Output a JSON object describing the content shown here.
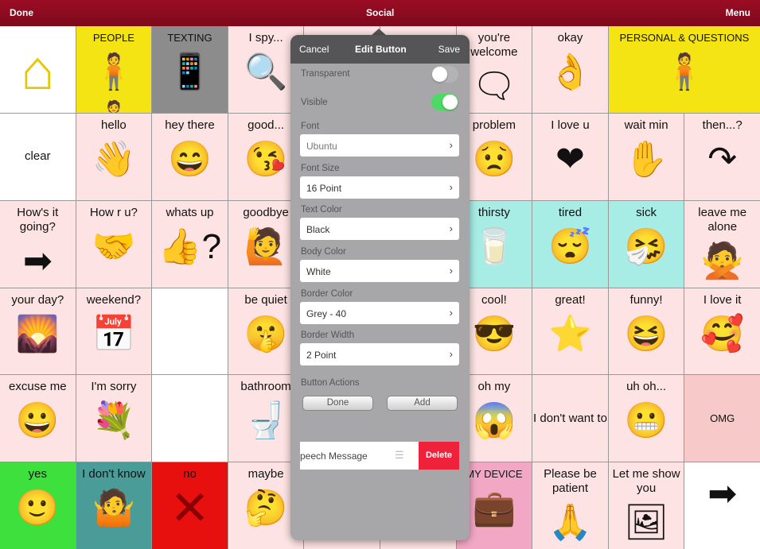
{
  "topbar": {
    "left": "Done",
    "title": "Social",
    "right": "Menu"
  },
  "cells": [
    {
      "label": "",
      "icon": "house-icon",
      "glyph": "⌂",
      "bg": "#ffffff"
    },
    {
      "label": "PEOPLE",
      "icon": "people-icon",
      "glyph": "🧍🧍🧍",
      "bg": "#f5e414"
    },
    {
      "label": "TEXTING",
      "icon": "phone-texting-icon",
      "glyph": "📱",
      "bg": "#8c8c8c"
    },
    {
      "label": "I spy...",
      "icon": "magnifier-icon",
      "glyph": "🔍",
      "bg": "#fde3e3"
    },
    {
      "label": "",
      "icon": "",
      "glyph": "",
      "bg": "#fde3e3"
    },
    {
      "label": "",
      "icon": "",
      "glyph": "",
      "bg": "#fde3e3"
    },
    {
      "label": "you're welcome",
      "icon": "people-talking-icon",
      "glyph": "🗨",
      "bg": "#fde3e3"
    },
    {
      "label": "okay",
      "icon": "ok-hand-icon",
      "glyph": "👌",
      "bg": "#fde3e3"
    },
    {
      "label": "PERSONAL & QUESTIONS",
      "icon": "person-icon",
      "glyph": "🧍",
      "bg": "#f5e414",
      "span": 2
    },
    {
      "label": "clear",
      "icon": "",
      "glyph": "",
      "bg": "#ffffff",
      "mid": true
    },
    {
      "label": "hello",
      "icon": "waving-icon",
      "glyph": "👋",
      "bg": "#fde3e3"
    },
    {
      "label": "hey there",
      "icon": "smiling-face-icon",
      "glyph": "😄",
      "bg": "#fde3e3"
    },
    {
      "label": "good...",
      "icon": "kiss-icon",
      "glyph": "😘",
      "bg": "#fde3e3"
    },
    {
      "label": "",
      "icon": "",
      "glyph": "",
      "bg": "#fde3e3"
    },
    {
      "label": "",
      "icon": "",
      "glyph": "",
      "bg": "#fde3e3"
    },
    {
      "label": "problem",
      "icon": "worried-icon",
      "glyph": "😟",
      "bg": "#fde3e3"
    },
    {
      "label": "I love u",
      "icon": "heart-icon",
      "glyph": "❤",
      "bg": "#fde3e3"
    },
    {
      "label": "wait min",
      "icon": "hand-stop-icon",
      "glyph": "✋",
      "bg": "#fde3e3"
    },
    {
      "label": "then...?",
      "icon": "arrow-next-icon",
      "glyph": "↷",
      "bg": "#fde3e3"
    },
    {
      "label": "How's it going?",
      "icon": "arrow-right-icon",
      "glyph": "➡",
      "bg": "#fde3e3"
    },
    {
      "label": "How r u?",
      "icon": "two-people-icon",
      "glyph": "🤝",
      "bg": "#fde3e3"
    },
    {
      "label": "whats up",
      "icon": "question-thumbs-icon",
      "glyph": "👍?",
      "bg": "#fde3e3"
    },
    {
      "label": "goodbye",
      "icon": "waving-person-icon",
      "glyph": "🙋",
      "bg": "#fde3e3"
    },
    {
      "label": "",
      "icon": "",
      "glyph": "",
      "bg": "#fde3e3"
    },
    {
      "label": "",
      "icon": "",
      "glyph": "",
      "bg": "#fde3e3"
    },
    {
      "label": "thirsty",
      "icon": "drink-icon",
      "glyph": "🥛",
      "bg": "#a8ece6"
    },
    {
      "label": "tired",
      "icon": "sleepy-icon",
      "glyph": "😴",
      "bg": "#a8ece6"
    },
    {
      "label": "sick",
      "icon": "sick-icon",
      "glyph": "🤧",
      "bg": "#a8ece6"
    },
    {
      "label": "leave me alone",
      "icon": "push-away-icon",
      "glyph": "🙅",
      "bg": "#fde3e3"
    },
    {
      "label": "your day?",
      "icon": "landscape-icon",
      "glyph": "🌄",
      "bg": "#fde3e3"
    },
    {
      "label": "weekend?",
      "icon": "calendar-icon",
      "glyph": "📅",
      "bg": "#fde3e3"
    },
    {
      "label": "",
      "icon": "",
      "glyph": "",
      "bg": "#ffffff"
    },
    {
      "label": "be quiet",
      "icon": "shush-icon",
      "glyph": "🤫",
      "bg": "#fde3e3"
    },
    {
      "label": "",
      "icon": "",
      "glyph": "",
      "bg": "#fde3e3"
    },
    {
      "label": "",
      "icon": "",
      "glyph": "",
      "bg": "#fde3e3"
    },
    {
      "label": "cool!",
      "icon": "sunglasses-icon",
      "glyph": "😎",
      "bg": "#fde3e3"
    },
    {
      "label": "great!",
      "icon": "star-icon",
      "glyph": "⭐",
      "bg": "#fde3e3"
    },
    {
      "label": "funny!",
      "icon": "laughing-icon",
      "glyph": "😆",
      "bg": "#fde3e3"
    },
    {
      "label": "I love it",
      "icon": "hug-heart-icon",
      "glyph": "🥰",
      "bg": "#fde3e3"
    },
    {
      "label": "excuse me",
      "icon": "smile-icon",
      "glyph": "😀",
      "bg": "#fde3e3"
    },
    {
      "label": "I'm sorry",
      "icon": "sorry-flower-icon",
      "glyph": "💐",
      "bg": "#fde3e3"
    },
    {
      "label": "",
      "icon": "",
      "glyph": "",
      "bg": "#ffffff"
    },
    {
      "label": "bathroom",
      "icon": "toilet-icon",
      "glyph": "🚽",
      "bg": "#fde3e3"
    },
    {
      "label": "",
      "icon": "",
      "glyph": "",
      "bg": "#fde3e3"
    },
    {
      "label": "",
      "icon": "",
      "glyph": "",
      "bg": "#fde3e3"
    },
    {
      "label": "oh my",
      "icon": "surprised-icon",
      "glyph": "😱",
      "bg": "#fde3e3"
    },
    {
      "label": "I don't want to",
      "icon": "",
      "glyph": "",
      "bg": "#fde3e3",
      "mid": true
    },
    {
      "label": "uh oh...",
      "icon": "uh-oh-icon",
      "glyph": "😬",
      "bg": "#fde3e3"
    },
    {
      "label": "OMG",
      "icon": "",
      "glyph": "",
      "bg": "#f7c9c9",
      "mid": true
    },
    {
      "label": "yes",
      "icon": "smile-icon",
      "glyph": "🙂",
      "bg": "#3ee03e"
    },
    {
      "label": "I don't know",
      "icon": "shrug-icon",
      "glyph": "🤷",
      "bg": "#4a9c98"
    },
    {
      "label": "no",
      "icon": "x-mark-icon",
      "glyph": "✕",
      "bg": "#e8100f"
    },
    {
      "label": "maybe",
      "icon": "question-person-icon",
      "glyph": "🤔",
      "bg": "#fde3e3"
    },
    {
      "label": "",
      "icon": "",
      "glyph": "",
      "bg": "#fde3e3"
    },
    {
      "label": "",
      "icon": "",
      "glyph": "",
      "bg": "#fde3e3"
    },
    {
      "label": "MY DEVICE",
      "icon": "device-icon",
      "glyph": "💼",
      "bg": "#f2a8c4"
    },
    {
      "label": "Please be patient",
      "icon": "patient-icon",
      "glyph": "🙏",
      "bg": "#fde3e3"
    },
    {
      "label": "Let me show you",
      "icon": "show-icon",
      "glyph": "🖼",
      "bg": "#fde3e3"
    },
    {
      "label": "",
      "icon": "arrow-right-icon",
      "glyph": "➡",
      "bg": "#ffffff"
    }
  ],
  "popover": {
    "cancel": "Cancel",
    "title": "Edit Button",
    "save": "Save",
    "transparent_label": "Transparent",
    "transparent_on": false,
    "visible_label": "Visible",
    "visible_on": true,
    "font_label": "Font",
    "font_value": "Ubuntu",
    "font_size_label": "Font Size",
    "font_size_value": "16 Point",
    "text_color_label": "Text Color",
    "text_color_value": "Black",
    "body_color_label": "Body Color",
    "body_color_value": "White",
    "border_color_label": "Border Color",
    "border_color_value": "Grey - 40",
    "border_width_label": "Border Width",
    "border_width_value": "2 Point",
    "actions_label": "Button Actions",
    "done": "Done",
    "add": "Add",
    "action_item": "peech Message",
    "delete": "Delete"
  },
  "colors": {
    "topbar": "#8b0b20",
    "toggle_on": "#4cd964",
    "delete": "#f0213a"
  }
}
